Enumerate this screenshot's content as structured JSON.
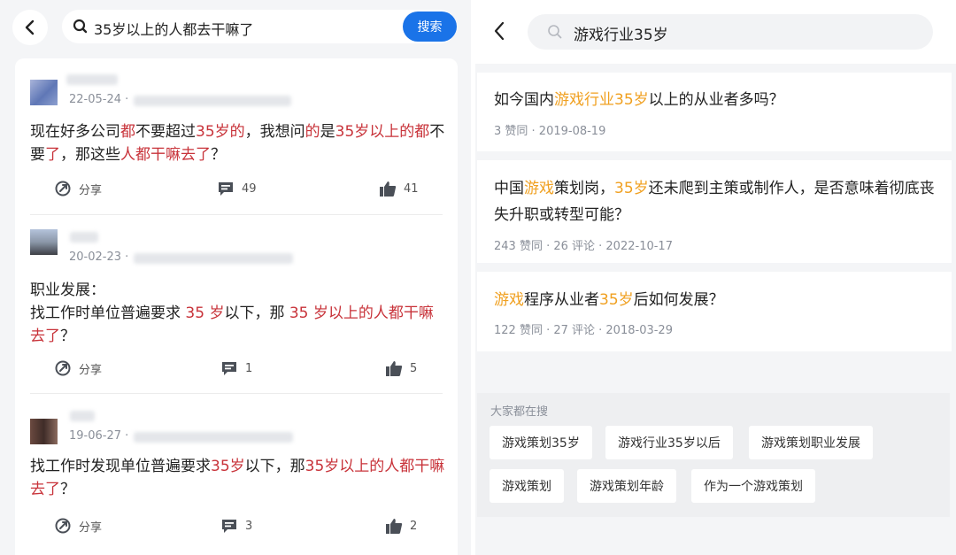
{
  "left": {
    "search": {
      "query": "35岁以上的人都去干嘛了",
      "button": "搜索"
    },
    "posts": [
      {
        "date": "22-05-24 ·",
        "segments": [
          {
            "t": "现在好多公司",
            "h": false
          },
          {
            "t": "都",
            "h": true
          },
          {
            "t": "不要超过",
            "h": false
          },
          {
            "t": "35岁的",
            "h": true
          },
          {
            "t": "，我想问",
            "h": false
          },
          {
            "t": "的",
            "h": true
          },
          {
            "t": "是",
            "h": false
          },
          {
            "t": "35岁以上的都",
            "h": true
          },
          {
            "t": "不要",
            "h": false
          },
          {
            "t": "了",
            "h": true
          },
          {
            "t": "，那这些",
            "h": false
          },
          {
            "t": "人都干嘛去了",
            "h": true
          },
          {
            "t": "？",
            "h": false
          }
        ],
        "share": "分享",
        "comments": "49",
        "likes": "41"
      },
      {
        "date": "20-02-23 ·",
        "segments": [
          {
            "t": "职业发展：",
            "h": false,
            "br": true
          },
          {
            "t": "找工作时单位普遍要求 ",
            "h": false
          },
          {
            "t": "35 岁",
            "h": true
          },
          {
            "t": "以下，那 ",
            "h": false
          },
          {
            "t": "35 岁以上的人都干嘛去了",
            "h": true
          },
          {
            "t": "？",
            "h": false
          }
        ],
        "share": "分享",
        "comments": "1",
        "likes": "5"
      },
      {
        "date": "19-06-27 ·",
        "segments": [
          {
            "t": "找工作时发现单位普遍要求",
            "h": false
          },
          {
            "t": "35岁",
            "h": true
          },
          {
            "t": "以下，那",
            "h": false
          },
          {
            "t": "35岁以上的人都干嘛去了",
            "h": true
          },
          {
            "t": "？",
            "h": false
          }
        ],
        "share": "分享",
        "comments": "3",
        "likes": "2"
      }
    ]
  },
  "right": {
    "search": {
      "query": "游戏行业35岁"
    },
    "results": [
      {
        "segments": [
          {
            "t": "如今国内",
            "h": false
          },
          {
            "t": "游戏行业35岁",
            "h": true
          },
          {
            "t": "以上的从业者多吗？",
            "h": false
          }
        ],
        "meta": "3 赞同 · 2019-08-19"
      },
      {
        "segments": [
          {
            "t": "中国",
            "h": false
          },
          {
            "t": "游戏",
            "h": true
          },
          {
            "t": "策划岗，",
            "h": false
          },
          {
            "t": "35岁",
            "h": true
          },
          {
            "t": "还未爬到主策或制作人，是否意味着彻底丧失升职或转型可能？",
            "h": false
          }
        ],
        "meta": "243 赞同 · 26 评论 · 2022-10-17"
      },
      {
        "segments": [
          {
            "t": "游戏",
            "h": true
          },
          {
            "t": "程序从业者",
            "h": false
          },
          {
            "t": "35岁",
            "h": true
          },
          {
            "t": "后如何发展？",
            "h": false
          }
        ],
        "meta": "122 赞同 · 27 评论 · 2018-03-29"
      }
    ],
    "trending": {
      "title": "大家都在搜",
      "tags": [
        "游戏策划35岁",
        "游戏行业35岁以后",
        "游戏策划职业发展",
        "游戏策划",
        "游戏策划年龄",
        "作为一个游戏策划"
      ]
    }
  },
  "colors": {
    "highlight_left": "#c8333a",
    "highlight_right": "#f0a020",
    "search_button": "#1a73e8"
  },
  "icons": [
    "back-icon",
    "search-icon",
    "share-icon",
    "comment-icon",
    "like-icon"
  ]
}
